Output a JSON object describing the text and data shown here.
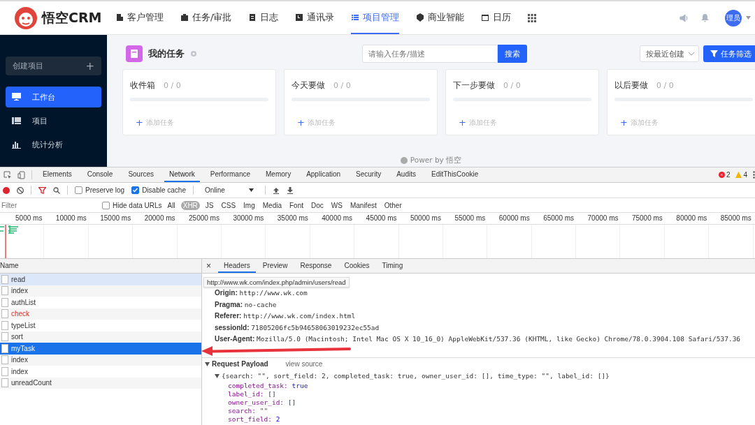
{
  "app": {
    "logo_text": "悟空CRM",
    "nav": [
      {
        "label": "客户管理",
        "selected": false
      },
      {
        "label": "任务/审批",
        "selected": false
      },
      {
        "label": "日志",
        "selected": false
      },
      {
        "label": "通讯录",
        "selected": false
      },
      {
        "label": "项目管理",
        "selected": true
      },
      {
        "label": "商业智能",
        "selected": false
      },
      {
        "label": "日历",
        "selected": false
      }
    ],
    "user_avatar": "理员",
    "sidebar": {
      "create_button": "创建项目",
      "create_icon": "+",
      "items": [
        {
          "label": "工作台",
          "selected": true
        },
        {
          "label": "项目",
          "selected": false
        },
        {
          "label": "统计分析",
          "selected": false
        }
      ]
    },
    "page_title": "我的任务",
    "search": {
      "placeholder": "请输入任务/描述",
      "button": "搜索"
    },
    "sort_select": "按最近创建",
    "filter_button": "任务筛选",
    "columns": [
      {
        "title": "收件箱",
        "count": "0 / 0",
        "add_icon": "+",
        "add": "添加任务"
      },
      {
        "title": "今天要做",
        "count": "0 / 0",
        "add_icon": "+",
        "add": "添加任务"
      },
      {
        "title": "下一步要做",
        "count": "0 / 0",
        "add_icon": "+",
        "add": "添加任务"
      },
      {
        "title": "以后要做",
        "count": "0 / 0",
        "add_icon": "+",
        "add": "添加任务"
      }
    ],
    "footer": "Power by 悟空"
  },
  "devtools": {
    "tabs": [
      {
        "label": "Elements",
        "selected": false
      },
      {
        "label": "Console",
        "selected": false
      },
      {
        "label": "Sources",
        "selected": false
      },
      {
        "label": "Network",
        "selected": true
      },
      {
        "label": "Performance",
        "selected": false
      },
      {
        "label": "Memory",
        "selected": false
      },
      {
        "label": "Application",
        "selected": false
      },
      {
        "label": "Security",
        "selected": false
      },
      {
        "label": "Audits",
        "selected": false
      },
      {
        "label": "EditThisCookie",
        "selected": false
      }
    ],
    "errors": "2",
    "warnings": "4",
    "preserve_log": {
      "label": "Preserve log",
      "checked": false
    },
    "disable_cache": {
      "label": "Disable cache",
      "checked": true
    },
    "throttling": "Online",
    "filter_placeholder": "Filter",
    "hide_data_urls": {
      "label": "Hide data URLs",
      "checked": false
    },
    "types": [
      {
        "label": "All",
        "selected": false
      },
      {
        "label": "XHR",
        "selected": true
      },
      {
        "label": "JS",
        "selected": false
      },
      {
        "label": "CSS",
        "selected": false
      },
      {
        "label": "Img",
        "selected": false
      },
      {
        "label": "Media",
        "selected": false
      },
      {
        "label": "Font",
        "selected": false
      },
      {
        "label": "Doc",
        "selected": false
      },
      {
        "label": "WS",
        "selected": false
      },
      {
        "label": "Manifest",
        "selected": false
      },
      {
        "label": "Other",
        "selected": false
      }
    ],
    "timeline_ticks": [
      "5000 ms",
      "10000 ms",
      "15000 ms",
      "20000 ms",
      "25000 ms",
      "30000 ms",
      "35000 ms",
      "40000 ms",
      "45000 ms",
      "50000 ms",
      "55000 ms",
      "60000 ms",
      "65000 ms",
      "70000 ms",
      "75000 ms",
      "80000 ms",
      "85000 ms"
    ],
    "list_header": "Name",
    "requests": [
      {
        "name": "read",
        "selected": false,
        "failed": false,
        "hovered": true
      },
      {
        "name": "index",
        "selected": false,
        "failed": false,
        "hovered": false
      },
      {
        "name": "authList",
        "selected": false,
        "failed": false,
        "hovered": false
      },
      {
        "name": "check",
        "selected": false,
        "failed": true,
        "hovered": false
      },
      {
        "name": "typeList",
        "selected": false,
        "failed": false,
        "hovered": false
      },
      {
        "name": "sort",
        "selected": false,
        "failed": false,
        "hovered": false
      },
      {
        "name": "myTask",
        "selected": true,
        "failed": false,
        "hovered": false
      },
      {
        "name": "index",
        "selected": false,
        "failed": false,
        "hovered": false
      },
      {
        "name": "index",
        "selected": false,
        "failed": false,
        "hovered": false
      },
      {
        "name": "unreadCount",
        "selected": false,
        "failed": false,
        "hovered": false
      }
    ],
    "detail_close": "×",
    "tooltip": "http://www.wk.com/index.php/admin/users/read",
    "detail_tabs": [
      {
        "label": "Headers",
        "selected": true
      },
      {
        "label": "Preview",
        "selected": false
      },
      {
        "label": "Response",
        "selected": false
      },
      {
        "label": "Cookies",
        "selected": false
      },
      {
        "label": "Timing",
        "selected": false
      }
    ],
    "headers": [
      {
        "name": "Origin:",
        "value": "http://www.wk.com"
      },
      {
        "name": "Pragma:",
        "value": "no-cache"
      },
      {
        "name": "Referer:",
        "value": "http://www.wk.com/index.html"
      },
      {
        "name": "sessionId:",
        "value": "71805206fc5b94658063019232ec55ad"
      },
      {
        "name": "User-Agent:",
        "value": "Mozilla/5.0 (Macintosh; Intel Mac OS X 10_16_0) AppleWebKit/537.36 (KHTML, like Gecko) Chrome/78.0.3904.108 Safari/537.36"
      }
    ],
    "payload": {
      "title": "Request Payload",
      "view_source": "view source",
      "summary": "{search: \"\", sort_field: 2, completed_task: true, owner_user_id: [], time_type: \"\", label_id: []}",
      "fields": [
        {
          "key": "completed_task:",
          "value": "true",
          "kind": "boolean"
        },
        {
          "key": "label_id:",
          "value": "[]",
          "kind": "array"
        },
        {
          "key": "owner_user_id:",
          "value": "[]",
          "kind": "array"
        },
        {
          "key": "search:",
          "value": "\"\"",
          "kind": "string"
        },
        {
          "key": "sort_field:",
          "value": "2",
          "kind": "number"
        }
      ]
    }
  }
}
